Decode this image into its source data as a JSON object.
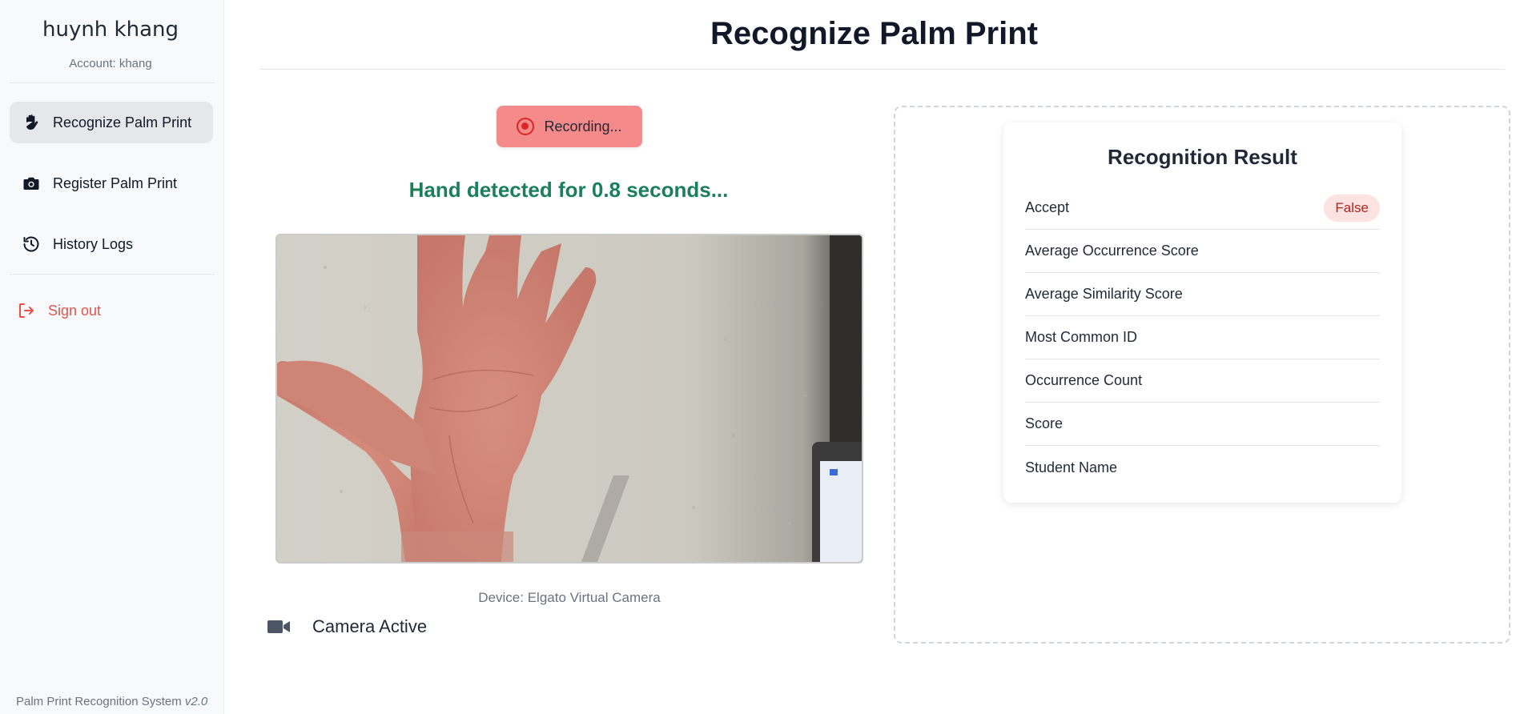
{
  "user": {
    "name": "huynh khang",
    "account": "Account: khang"
  },
  "sidebar": {
    "items": [
      {
        "label": "Recognize Palm Print",
        "icon": "hand-icon",
        "active": true
      },
      {
        "label": "Register Palm Print",
        "icon": "camera-icon",
        "active": false
      },
      {
        "label": "History Logs",
        "icon": "history-icon",
        "active": false
      }
    ],
    "signout": {
      "label": "Sign out",
      "icon": "sign-out-icon"
    },
    "footer": {
      "text": "Palm Print Recognition System",
      "version": "v2.0"
    }
  },
  "header": {
    "title": "Recognize Palm Print"
  },
  "recording": {
    "button_label": "Recording...",
    "status_text": "Hand detected for 0.8 seconds..."
  },
  "camera": {
    "device_label": "Device: Elgato Virtual Camera",
    "status": "Camera Active",
    "status_icon": "video-camera-icon"
  },
  "result": {
    "title": "Recognition Result",
    "rows": [
      {
        "label": "Accept",
        "value": "False"
      },
      {
        "label": "Average Occurrence Score",
        "value": ""
      },
      {
        "label": "Average Similarity Score",
        "value": ""
      },
      {
        "label": "Most Common ID",
        "value": ""
      },
      {
        "label": "Occurrence Count",
        "value": ""
      },
      {
        "label": "Score",
        "value": ""
      },
      {
        "label": "Student Name",
        "value": ""
      }
    ]
  },
  "colors": {
    "accent_status": "#1a7f5a",
    "recording_bg": "#f58a8a",
    "signout": "#e5534b",
    "badge_false_bg": "#fde2e2",
    "badge_false_text": "#b42318"
  }
}
